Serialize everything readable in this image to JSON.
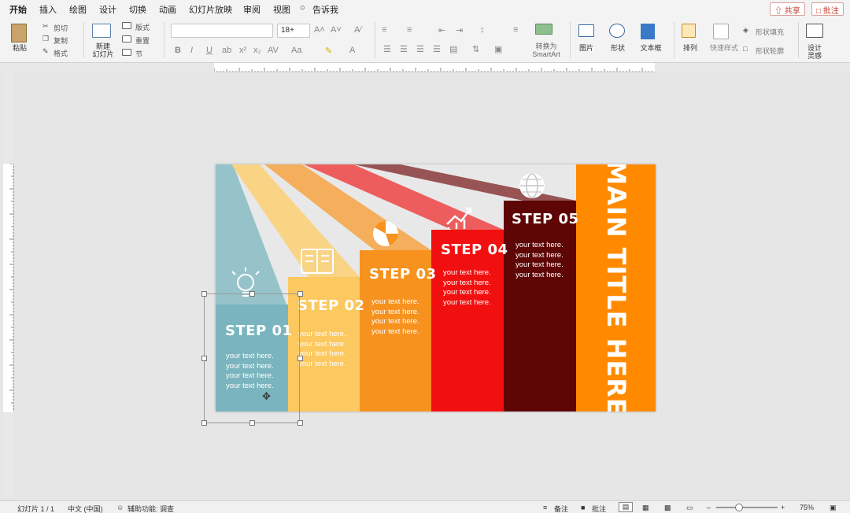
{
  "tabs": [
    "开始",
    "插入",
    "绘图",
    "设计",
    "切换",
    "动画",
    "幻灯片放映",
    "审阅",
    "视图",
    "告诉我"
  ],
  "actions": {
    "share": "共享",
    "comment": "批注"
  },
  "ribbon": {
    "paste": "粘贴",
    "cut": "剪切",
    "copy": "复制",
    "format": "格式",
    "new_slide": "新建\n幻灯片",
    "layout": "版式",
    "reset": "重置",
    "section": "节",
    "font_size": "18+",
    "convert_smartart": "转换为\nSmartArt",
    "picture": "图片",
    "shape": "形状",
    "textbox": "文本框",
    "arrange": "排列",
    "quick_styles": "快速样式",
    "shape_fill": "形状填充",
    "shape_outline": "形状轮廓",
    "design_ideas": "设计\n灵感"
  },
  "slide": {
    "main_title": "MAIN TITLE HERE",
    "steps": [
      {
        "title": "STEP 01",
        "text": "your text here.\nyour text here.\nyour text here.\nyour text here.",
        "color": "#7ab5bf",
        "icon": "lightbulb-icon"
      },
      {
        "title": "STEP 02",
        "text": "your text here.\nyour text here.\nyour text here.\nyour text here.",
        "color": "#fcc860",
        "icon": "book-icon"
      },
      {
        "title": "STEP 03",
        "text": "your text here.\nyour text here.\nyour text here.\nyour text here.",
        "color": "#f7921e",
        "icon": "pie-chart-icon"
      },
      {
        "title": "STEP 04",
        "text": "your text here.\nyour text here.\nyour text here.\nyour text here.",
        "color": "#f20f0f",
        "icon": "growth-chart-icon"
      },
      {
        "title": "STEP 05",
        "text": "your text here.\nyour text here.\nyour text here.\nyour text here.",
        "color": "#5e0505",
        "icon": "globe-icon"
      }
    ],
    "title_bar_color": "#ff8a00"
  },
  "status": {
    "slide_count": "幻灯片 1 / 1",
    "language": "中文 (中国)",
    "accessibility": "辅助功能: 调查",
    "notes": "备注",
    "comments": "批注",
    "zoom": "75%"
  }
}
